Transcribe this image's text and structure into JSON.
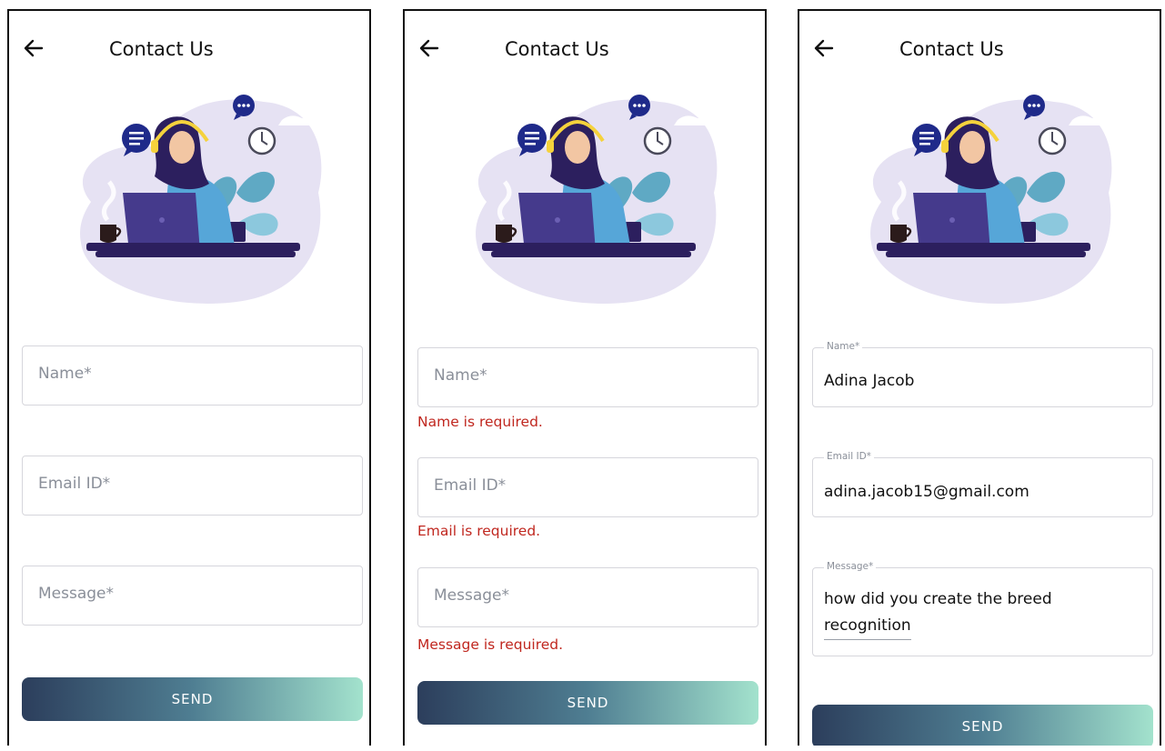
{
  "header": {
    "title": "Contact Us"
  },
  "icons": {
    "back": "arrow-left-icon"
  },
  "colors": {
    "error": "#c0271f",
    "send_gradient_start": "#2c3e5c",
    "send_gradient_end": "#a3e2cd",
    "blob": "#e6e2f3"
  },
  "form": {
    "name_placeholder": "Name*",
    "email_placeholder": "Email ID*",
    "message_placeholder": "Message*",
    "send_label": "SEND"
  },
  "errors": {
    "name": "Name is required.",
    "email": "Email is required.",
    "message": "Message is required."
  },
  "filled": {
    "name_label": "Name*",
    "name_value": "Adina Jacob",
    "email_label": "Email ID*",
    "email_value": "adina.jacob15@gmail.com",
    "message_label": "Message*",
    "message_line1": "how did you create the breed",
    "message_line2": "recognition"
  }
}
